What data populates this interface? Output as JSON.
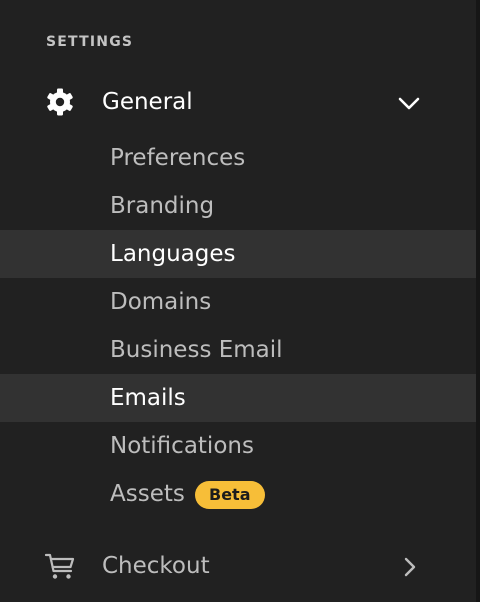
{
  "sidebar": {
    "section_heading": "SETTINGS",
    "general": {
      "label": "General",
      "icon": "gear-icon",
      "chevron": "chevron-down-icon",
      "expanded": true,
      "items": [
        {
          "label": "Preferences",
          "active": false
        },
        {
          "label": "Branding",
          "active": false
        },
        {
          "label": "Languages",
          "active": true
        },
        {
          "label": "Domains",
          "active": false
        },
        {
          "label": "Business Email",
          "active": false
        },
        {
          "label": "Emails",
          "active": true
        },
        {
          "label": "Notifications",
          "active": false
        },
        {
          "label": "Assets",
          "active": false,
          "badge": "Beta"
        }
      ]
    },
    "checkout": {
      "label": "Checkout",
      "icon": "cart-icon",
      "chevron": "chevron-right-icon"
    }
  },
  "colors": {
    "background": "#212121",
    "active_row": "#323232",
    "badge": "#f7be38",
    "text_primary": "#ffffff",
    "text_secondary": "#bdbdbd"
  }
}
